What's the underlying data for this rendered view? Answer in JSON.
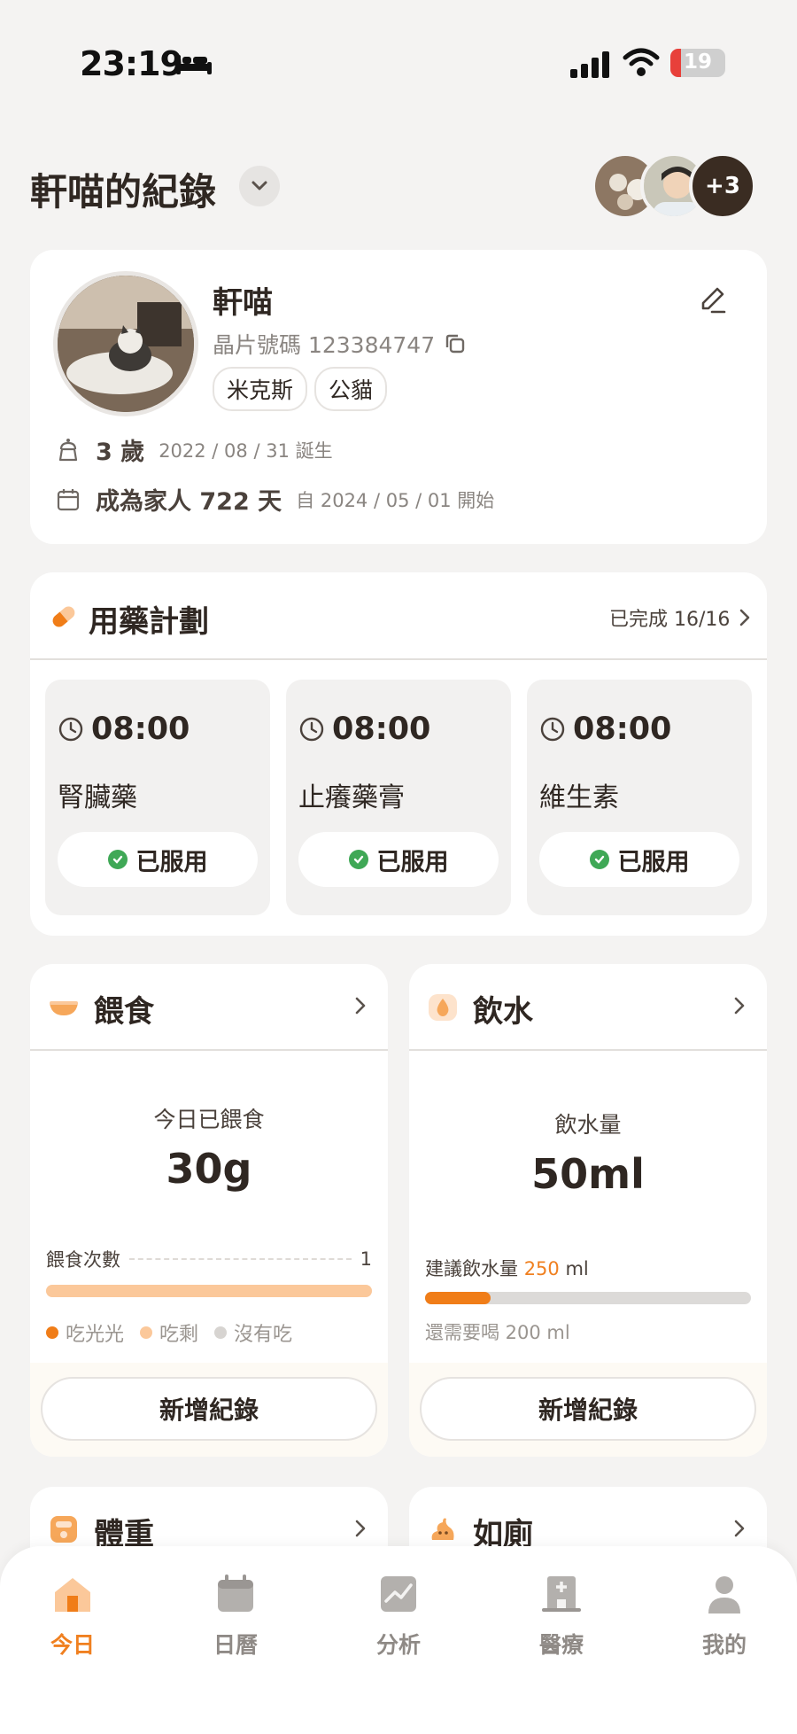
{
  "status_bar": {
    "time": "23:19",
    "battery": "19"
  },
  "header": {
    "title": "軒喵的紀錄",
    "members_more": "+3"
  },
  "profile": {
    "name": "軒喵",
    "chip_label": "晶片號碼 123384747",
    "tags": [
      "米克斯",
      "公貓"
    ],
    "age_value": "3 歲",
    "birthday": "2022 / 08 / 31 誕生",
    "family_value": "成為家人 722 天",
    "family_since": "自 2024 / 05 / 01 開始"
  },
  "medication": {
    "title": "用藥計劃",
    "progress": "已完成 16/16",
    "items": [
      {
        "time": "08:00",
        "name": "腎臟藥",
        "status": "已服用"
      },
      {
        "time": "08:00",
        "name": "止癢藥膏",
        "status": "已服用"
      },
      {
        "time": "08:00",
        "name": "維生素",
        "status": "已服用"
      }
    ]
  },
  "feeding": {
    "title": "餵食",
    "label": "今日已餵食",
    "value": "30g",
    "count_label": "餵食次數",
    "count_value": "1",
    "bar_fill": 1.0,
    "legend": [
      "吃光光",
      "吃剩",
      "沒有吃"
    ],
    "add_label": "新增紀錄"
  },
  "water": {
    "title": "飲水",
    "label": "飲水量",
    "value": "50ml",
    "suggest_prefix": "建議飲水量",
    "suggest_value": "250",
    "suggest_unit": "ml",
    "progress": 0.2,
    "remaining": "還需要喝 200 ml",
    "add_label": "新增紀錄"
  },
  "weight": {
    "title": "體重"
  },
  "toilet": {
    "title": "如廁"
  },
  "tabs": [
    {
      "label": "今日",
      "icon": "home-icon",
      "active": true
    },
    {
      "label": "日曆",
      "icon": "calendar-icon",
      "active": false
    },
    {
      "label": "分析",
      "icon": "chart-icon",
      "active": false
    },
    {
      "label": "醫療",
      "icon": "hospital-icon",
      "active": false
    },
    {
      "label": "我的",
      "icon": "person-icon",
      "active": false
    }
  ],
  "colors": {
    "accent": "#f08020",
    "feeding_bar": "#fbc89a",
    "water_bar": "#f07d18",
    "check": "#3fa856"
  }
}
